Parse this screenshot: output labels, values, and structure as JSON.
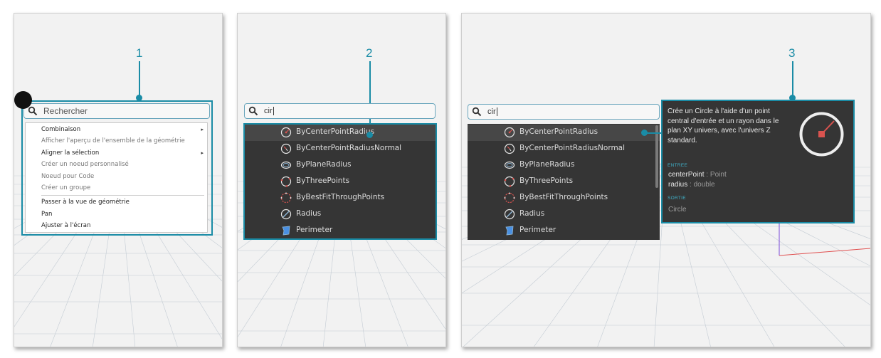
{
  "callouts": {
    "one": "1",
    "two": "2",
    "three": "3"
  },
  "panel1": {
    "search_placeholder": "Rechercher",
    "menu_items": [
      {
        "label": "Combinaison",
        "submenu": true,
        "disabled": false
      },
      {
        "label": "Afficher l'aperçu de l'ensemble de la géométrie",
        "submenu": false,
        "disabled": true
      },
      {
        "label": "Aligner la sélection",
        "submenu": true,
        "disabled": false
      },
      {
        "label": "Créer un noeud personnalisé",
        "submenu": false,
        "disabled": true
      },
      {
        "label": "Noeud pour Code",
        "submenu": false,
        "disabled": true
      },
      {
        "label": "Créer un groupe",
        "submenu": false,
        "disabled": true
      },
      {
        "label": "Passer à la vue de géométrie",
        "submenu": false,
        "disabled": false
      },
      {
        "label": "Pan",
        "submenu": false,
        "disabled": false
      },
      {
        "label": "Ajuster à l'écran",
        "submenu": false,
        "disabled": false
      }
    ],
    "submenu_arrow": "▸"
  },
  "search_results": {
    "query": "cir",
    "items": [
      {
        "label": "ByCenterPointRadius",
        "icon": "circle-center-radius-icon"
      },
      {
        "label": "ByCenterPointRadiusNormal",
        "icon": "circle-center-radius-normal-icon"
      },
      {
        "label": "ByPlaneRadius",
        "icon": "circle-plane-radius-icon"
      },
      {
        "label": "ByThreePoints",
        "icon": "circle-three-points-icon"
      },
      {
        "label": "ByBestFitThroughPoints",
        "icon": "circle-best-fit-icon"
      },
      {
        "label": "Radius",
        "icon": "radius-icon"
      },
      {
        "label": "Perimeter",
        "icon": "perimeter-icon"
      }
    ]
  },
  "tooltip": {
    "description": "Crée un Circle à l'aide d'un point central d'entrée et un rayon dans le plan XY univers, avec l'univers Z standard.",
    "inputs_header": "ENTREE",
    "inputs": [
      {
        "name": "centerPoint",
        "type": " : Point"
      },
      {
        "name": "radius",
        "type": " : double"
      }
    ],
    "output_header": "SORTIE",
    "output": "Circle"
  },
  "colors": {
    "accent": "#1a8ca6",
    "dark_panel": "#353535",
    "icon_red": "#d9534f"
  }
}
